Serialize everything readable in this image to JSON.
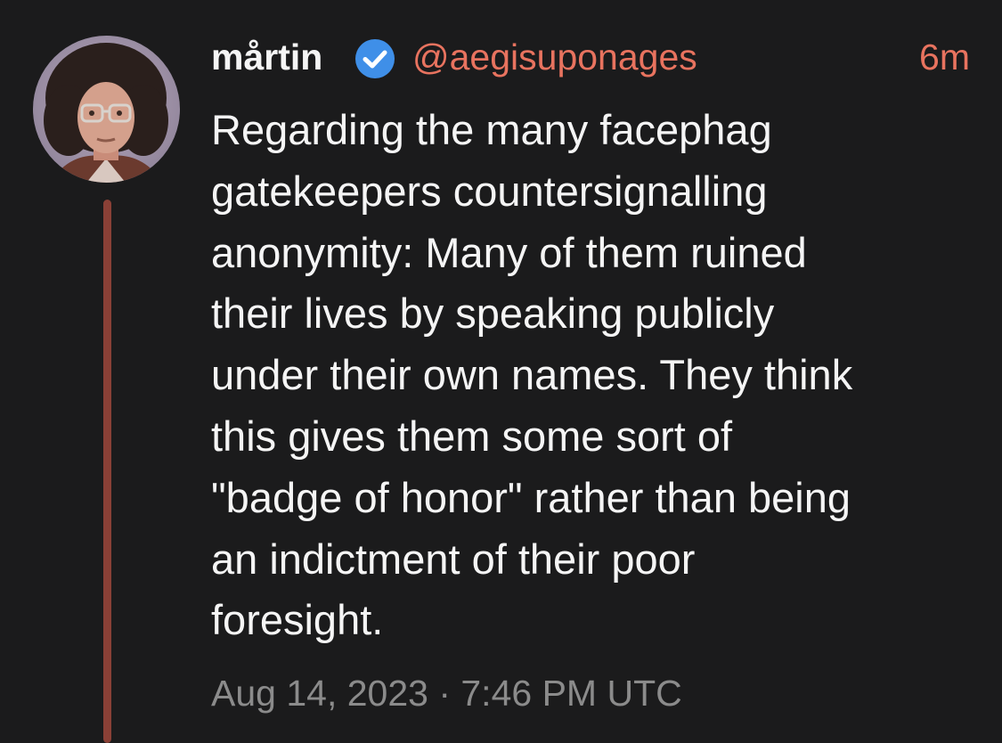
{
  "post": {
    "display_name": "mårtin",
    "verified_icon": "verified-check-icon",
    "handle": "@aegisuponages",
    "relative_time": "6m",
    "lines": [
      "Regarding the many facephag",
      "gatekeepers countersignalling",
      "anonymity:  Many of them ruined",
      "their lives by speaking publicly",
      "under their own names. They think",
      "this gives them some sort of",
      "\"badge of honor\" rather than being",
      "an indictment of their poor",
      "foresight."
    ],
    "timestamp": "Aug 14, 2023 · 7:46 PM UTC"
  },
  "colors": {
    "background": "#1b1b1c",
    "text": "#f5f5f5",
    "handle_accent": "#e8735f",
    "verified_blue": "#3f8fe8",
    "thread_line": "#8a4036",
    "muted": "#8b8b8b"
  }
}
